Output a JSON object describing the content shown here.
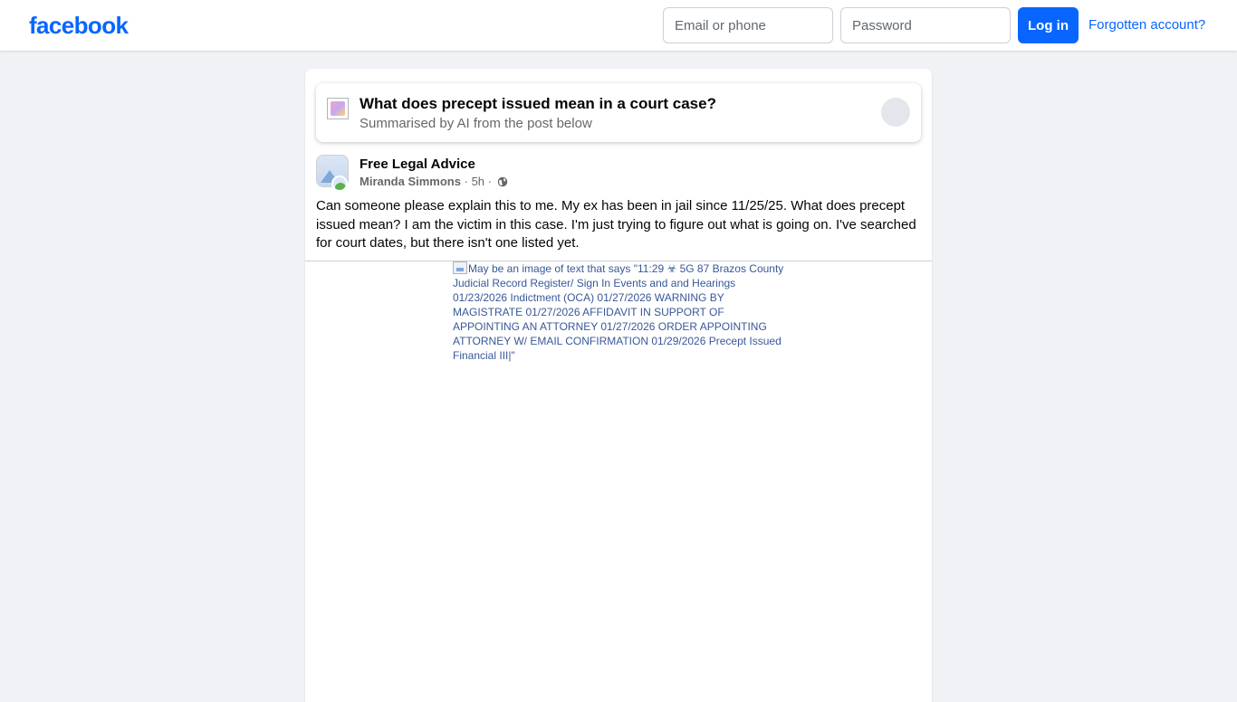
{
  "header": {
    "logo": "facebook",
    "email_placeholder": "Email or phone",
    "password_placeholder": "Password",
    "login_label": "Log in",
    "forgot_label": "Forgotten account?"
  },
  "ai_summary": {
    "icon": "ai-summary-icon",
    "title": "What does precept issued mean in a court case?",
    "subtitle": "Summarised by AI from the post below"
  },
  "post": {
    "group_name": "Free Legal Advice",
    "author": "Miranda Simmons",
    "time": "5h",
    "separator": "·",
    "privacy_icon": "globe-icon",
    "text": "Can someone please explain this to me. My ex has been in jail since 11/25/25. What does precept issued mean? I am the victim in this case. I'm just trying to figure out what is going on. I've searched for court dates, but there isn't one listed yet.",
    "image_alt": "May be an image of text that says \"11:29 ☣ 5G 87 Brazos County Judicial Record Register/ Sign In Events and and Hearings 01/23/2026 Indictment (OCA) 01/27/2026 WARNING BY MAGISTRATE 01/27/2026 AFFIDAVIT IN SUPPORT OF APPOINTING AN ATTORNEY 01/27/2026 ORDER APPOINTING ATTORNEY W/ EMAIL CONFIRMATION 01/29/2026 Precept Issued Financial III|\""
  },
  "colors": {
    "brand": "#0866ff",
    "background": "#f0f2f5",
    "secondary_text": "#65676b"
  }
}
